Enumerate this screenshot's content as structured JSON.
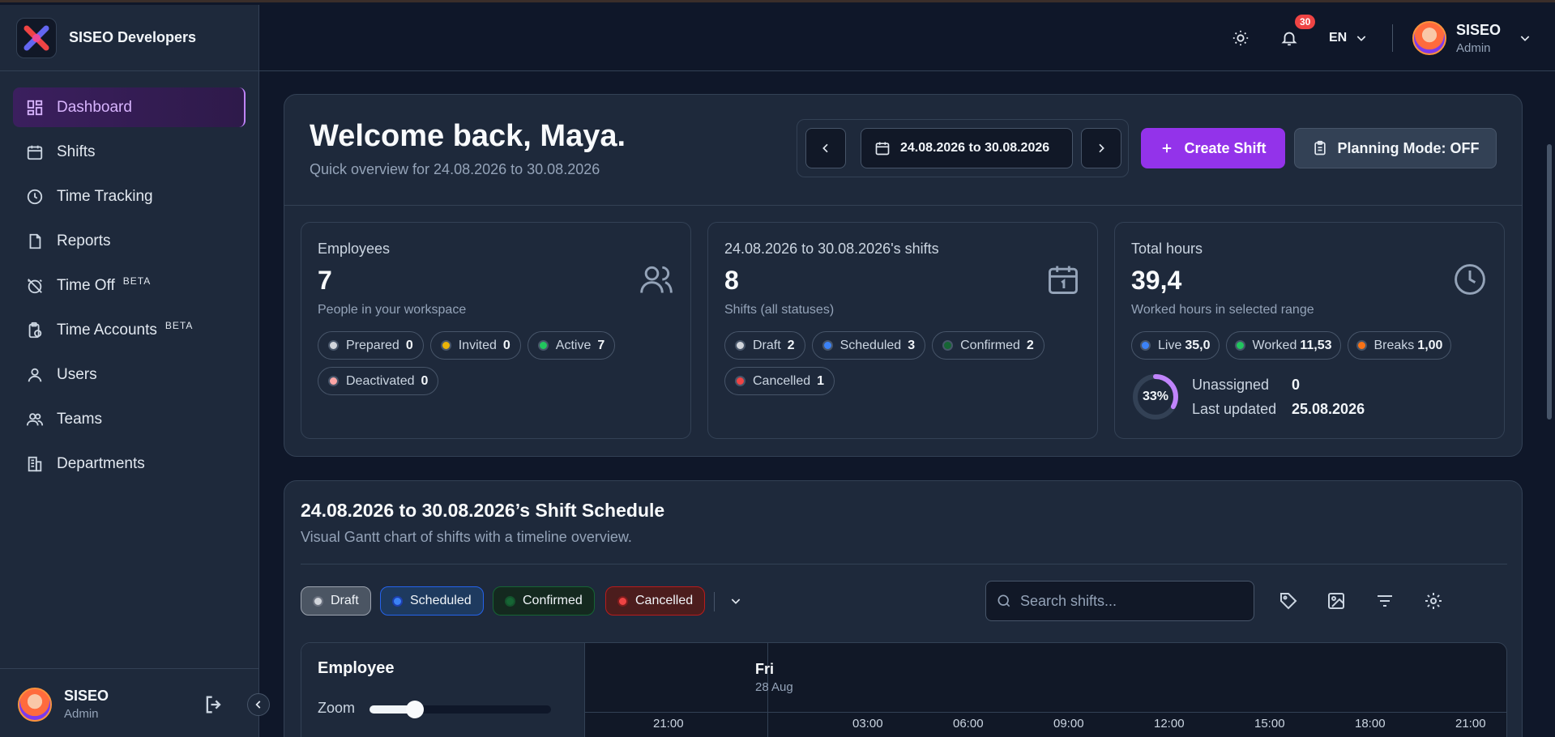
{
  "brand": {
    "name": "SISEO Developers"
  },
  "sidebar": {
    "items": [
      {
        "label": "Dashboard"
      },
      {
        "label": "Shifts"
      },
      {
        "label": "Time Tracking"
      },
      {
        "label": "Reports"
      },
      {
        "label": "Time Off",
        "badge": "BETA"
      },
      {
        "label": "Time Accounts",
        "badge": "BETA"
      },
      {
        "label": "Users"
      },
      {
        "label": "Teams"
      },
      {
        "label": "Departments"
      }
    ],
    "user": {
      "name": "SISEO",
      "role": "Admin"
    }
  },
  "topbar": {
    "notifications": "30",
    "language": "EN",
    "user": {
      "name": "SISEO",
      "role": "Admin"
    }
  },
  "welcome": {
    "title": "Welcome back, Maya.",
    "subtitle": "Quick overview for 24.08.2026 to 30.08.2026",
    "date_range": "24.08.2026 to 30.08.2026",
    "create_label": "Create Shift",
    "planning_label": "Planning Mode: OFF"
  },
  "stats": {
    "employees": {
      "label": "Employees",
      "value": "7",
      "desc": "People in your workspace",
      "pills": [
        {
          "label": "Prepared",
          "count": "0",
          "color": "#d1d5db"
        },
        {
          "label": "Invited",
          "count": "0",
          "color": "#eab308"
        },
        {
          "label": "Active",
          "count": "7",
          "color": "#22c55e"
        },
        {
          "label": "Deactivated",
          "count": "0",
          "color": "#fca5a5"
        }
      ]
    },
    "shifts": {
      "label": "24.08.2026 to 30.08.2026's shifts",
      "value": "8",
      "desc": "Shifts (all statuses)",
      "pills": [
        {
          "label": "Draft",
          "count": "2",
          "color": "#d1d5db"
        },
        {
          "label": "Scheduled",
          "count": "3",
          "color": "#3b82f6"
        },
        {
          "label": "Confirmed",
          "count": "2",
          "color": "#166534"
        },
        {
          "label": "Cancelled",
          "count": "1",
          "color": "#ef4444"
        }
      ]
    },
    "hours": {
      "label": "Total hours",
      "value": "39,4",
      "desc": "Worked hours in selected range",
      "pills": [
        {
          "label": "Live",
          "count": "35,0",
          "color": "#3b82f6"
        },
        {
          "label": "Worked",
          "count": "11,53",
          "color": "#22c55e"
        },
        {
          "label": "Breaks",
          "count": "1,00",
          "color": "#f97316"
        }
      ],
      "ring": {
        "label": "33%",
        "percent": 33
      },
      "unassigned_label": "Unassigned",
      "unassigned_value": "0",
      "updated_label": "Last updated",
      "updated_value": "25.08.2026"
    }
  },
  "schedule": {
    "title": "24.08.2026 to 30.08.2026’s Shift Schedule",
    "subtitle": "Visual Gantt chart of shifts with a timeline overview.",
    "filters": [
      "Draft",
      "Scheduled",
      "Confirmed",
      "Cancelled"
    ],
    "search_placeholder": "Search shifts...",
    "gantt": {
      "employee_label": "Employee",
      "zoom_label": "Zoom",
      "zoom_level": 0.2,
      "day_name": "Fri",
      "day_date": "28 Aug",
      "times": [
        "21:00",
        "03:00",
        "06:00",
        "09:00",
        "12:00",
        "15:00",
        "18:00",
        "21:00"
      ]
    }
  },
  "colors": {
    "accent": "#9333ea",
    "bg": "#0f1729",
    "card": "#1e293b"
  }
}
